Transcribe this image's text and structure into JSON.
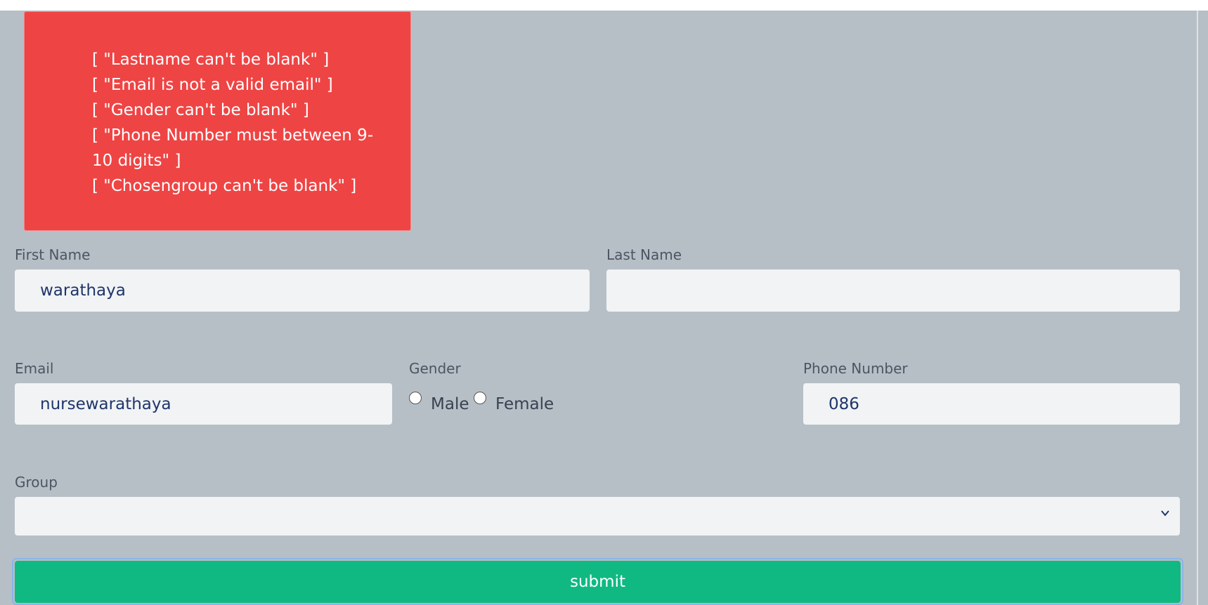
{
  "errors": [
    "[ \"Lastname can't be blank\" ]",
    "[ \"Email is not a valid email\" ]",
    "[ \"Gender can't be blank\" ]",
    "[ \"Phone Number must between 9-10 digits\" ]",
    "[ \"Chosengroup can't be blank\" ]"
  ],
  "form": {
    "first_name": {
      "label": "First Name",
      "value": "warathaya"
    },
    "last_name": {
      "label": "Last Name",
      "value": ""
    },
    "email": {
      "label": "Email",
      "value": "nursewarathaya"
    },
    "gender": {
      "label": "Gender",
      "options": [
        "Male",
        "Female"
      ],
      "selected": null
    },
    "phone": {
      "label": "Phone Number",
      "value": "086"
    },
    "group": {
      "label": "Group",
      "selected": ""
    },
    "submit_label": "submit"
  },
  "colors": {
    "background": "#b7bfc6",
    "error_bg": "#ef4444",
    "input_bg": "#f1f3f5",
    "submit_bg": "#10b981",
    "input_text": "#1f3569"
  },
  "icons": {
    "select_arrow": "chevron-down-icon"
  }
}
